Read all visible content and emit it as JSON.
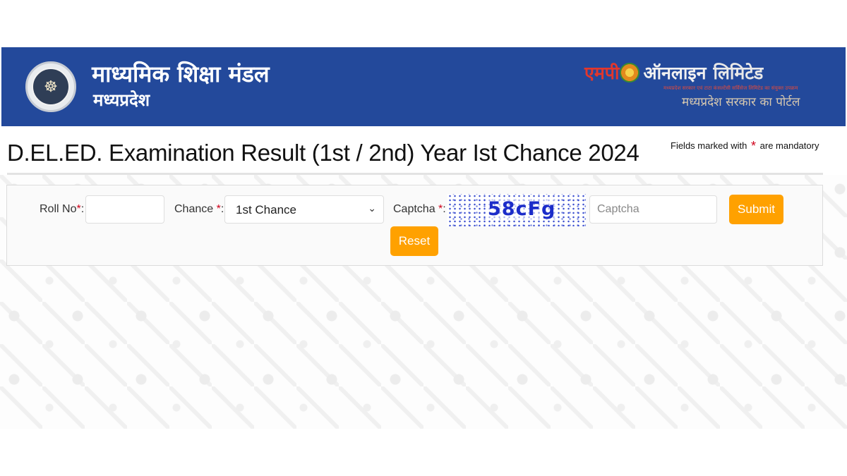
{
  "header": {
    "board_name": "माध्यमिक शिक्षा मंडल",
    "board_state": "मध्यप्रदेश",
    "emblem_text": "☸",
    "partner_logo": {
      "part1": "एमपी",
      "part2": "ऑनलाइन",
      "part3": "लिमिटेड",
      "tagline_small": "मध्यप्रदेश सरकार एवं टाटा कंसल्टेंसी सर्विसेज लिमिटेड का संयुक्त उपक्रम",
      "tagline": "मध्यप्रदेश सरकार का पोर्टल"
    }
  },
  "page": {
    "title": "D.EL.ED. Examination Result (1st / 2nd) Year Ist Chance 2024",
    "mandatory_prefix": "Fields marked with",
    "mandatory_star": "*",
    "mandatory_suffix": "are mandatory"
  },
  "form": {
    "roll_label": "Roll No",
    "roll_value": "",
    "chance_label": "Chance",
    "chance_selected": "1st Chance",
    "captcha_label": "Captcha",
    "captcha_image_text": "58cFg",
    "captcha_placeholder": "Captcha",
    "required_mark": "*",
    "colon": ":",
    "submit_label": "Submit",
    "reset_label": "Reset"
  },
  "colors": {
    "header_bg": "#23499b",
    "button_bg": "#ffa100",
    "required": "#d0021b"
  }
}
